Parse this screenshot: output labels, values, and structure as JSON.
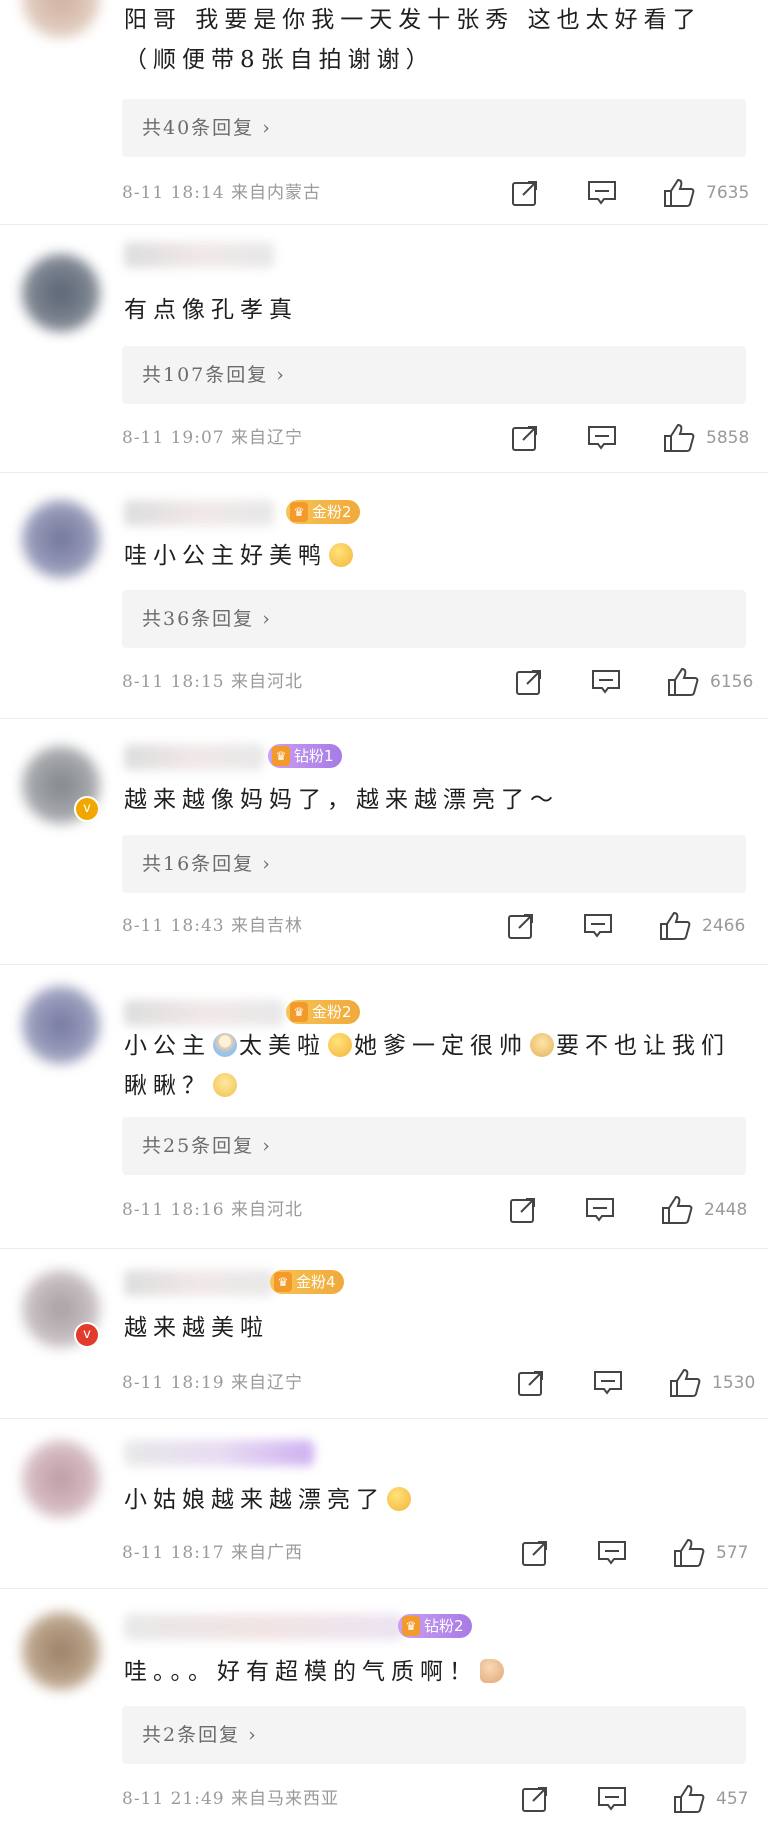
{
  "comments": [
    {
      "text": "阳哥 我要是你我一天发十张秀 这也太好看了（顺便带8张自拍谢谢）",
      "replies": "共40条回复 ›",
      "meta": "8-11 18:14 来自内蒙古",
      "likes": "7635"
    },
    {
      "text": "有点像孔孝真",
      "replies": "共107条回复 ›",
      "meta": "8-11 19:07 来自辽宁",
      "likes": "5858"
    },
    {
      "badge": "金粉2",
      "text": "哇小公主好美鸭",
      "replies": "共36条回复 ›",
      "meta": "8-11 18:15 来自河北",
      "likes": "6156"
    },
    {
      "badge": "钻粉1",
      "text": "越来越像妈妈了，越来越漂亮了～",
      "replies": "共16条回复 ›",
      "meta": "8-11 18:43 来自吉林",
      "likes": "2466"
    },
    {
      "badge": "金粉2",
      "text_a": "小公主",
      "text_b": "太美啦",
      "text_c": "她爹一定很帅",
      "text_d": "要不也让我们瞅瞅？",
      "replies": "共25条回复 ›",
      "meta": "8-11 18:16 来自河北",
      "likes": "2448"
    },
    {
      "badge": "金粉4",
      "text": "越来越美啦",
      "meta": "8-11 18:19 来自辽宁",
      "likes": "1530"
    },
    {
      "text": "小姑娘越来越漂亮了",
      "meta": "8-11 18:17 来自广西",
      "likes": "577"
    },
    {
      "badge": "钻粉2",
      "text": "哇。。。好有超模的气质啊！",
      "replies": "共2条回复 ›",
      "meta": "8-11 21:49 来自马来西亚",
      "likes": "457"
    }
  ],
  "icons": {
    "share": "share-icon",
    "comment": "comment-icon",
    "like": "like-icon",
    "verified": "verified-icon",
    "medal": "medal-icon"
  },
  "colors": {
    "gold_badge": "#f1a93a",
    "diamond_badge": "#a77ae6",
    "verified_gold": "#f0a800",
    "verified_red": "#e23b2e",
    "reply_box": "#f4f4f5"
  }
}
